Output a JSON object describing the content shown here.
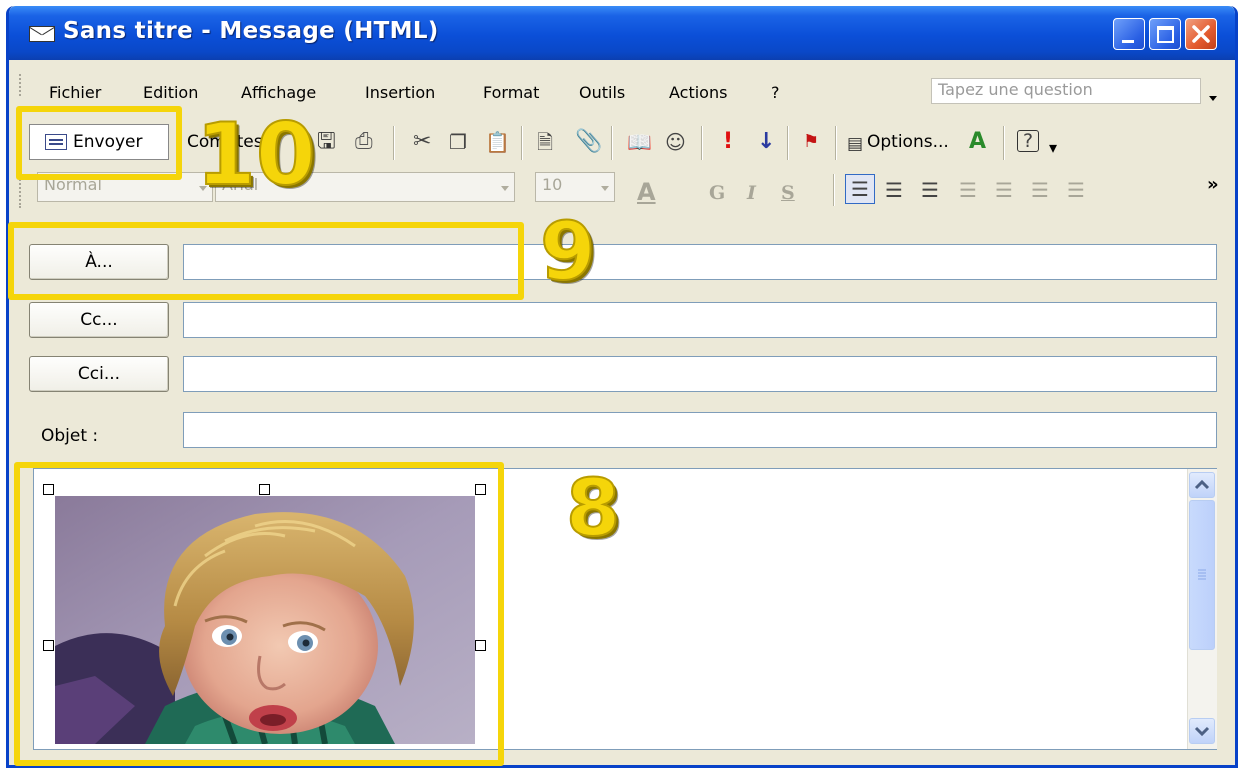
{
  "window": {
    "title": "Sans titre - Message (HTML)"
  },
  "menu": {
    "items": [
      "Fichier",
      "Edition",
      "Affichage",
      "Insertion",
      "Format",
      "Outils",
      "Actions",
      "?"
    ],
    "ask_placeholder": "Tapez une question"
  },
  "toolbar": {
    "send_label": "Envoyer",
    "accounts_label": "Comptes",
    "options_label": "Options...",
    "icons": [
      "save-icon",
      "print-icon",
      "cut-icon",
      "copy-icon",
      "paste-icon",
      "insert-file-icon",
      "attach-icon",
      "address-book-icon",
      "check-names-icon",
      "importance-high-icon",
      "importance-low-icon",
      "flag-icon",
      "options-icon",
      "signature-icon",
      "help-icon"
    ]
  },
  "format_bar": {
    "style": "Normal",
    "font": "Arial",
    "size": "10",
    "bold": "G",
    "italic": "I",
    "underline": "S"
  },
  "header": {
    "to_label": "À...",
    "cc_label": "Cc...",
    "bcc_label": "Cci...",
    "subject_label": "Objet :",
    "to_value": "",
    "cc_value": "",
    "bcc_value": "",
    "subject_value": ""
  },
  "annotations": {
    "n10": "10",
    "n9": "9",
    "n8": "8",
    "color": "#f5d50a"
  },
  "colors": {
    "titlebar": "#0b4fd8",
    "chrome": "#ece9d8",
    "field_border": "#7f9db9"
  }
}
